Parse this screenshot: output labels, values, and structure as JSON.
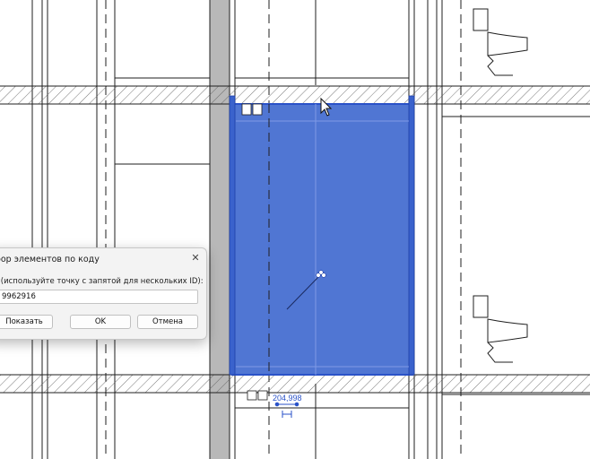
{
  "drawing": {
    "dimension_value": "204,998",
    "colors": {
      "selection_fill": "#4a72d2",
      "selection_outline": "#2a52c8",
      "wall_gray": "#b8b8b8",
      "line": "#1f1f1f"
    },
    "icons": [
      "toilet-icon",
      "mouse-cursor-icon",
      "move-handle-icon"
    ]
  },
  "dialog": {
    "title": "бор элементов по коду",
    "id_label": "- (используйте точку с запятой для нескольких ID):",
    "id_value": "9962916",
    "show_button": "Показать",
    "ok_button": "OK",
    "cancel_button": "Отмена",
    "close_glyph": "✕"
  }
}
